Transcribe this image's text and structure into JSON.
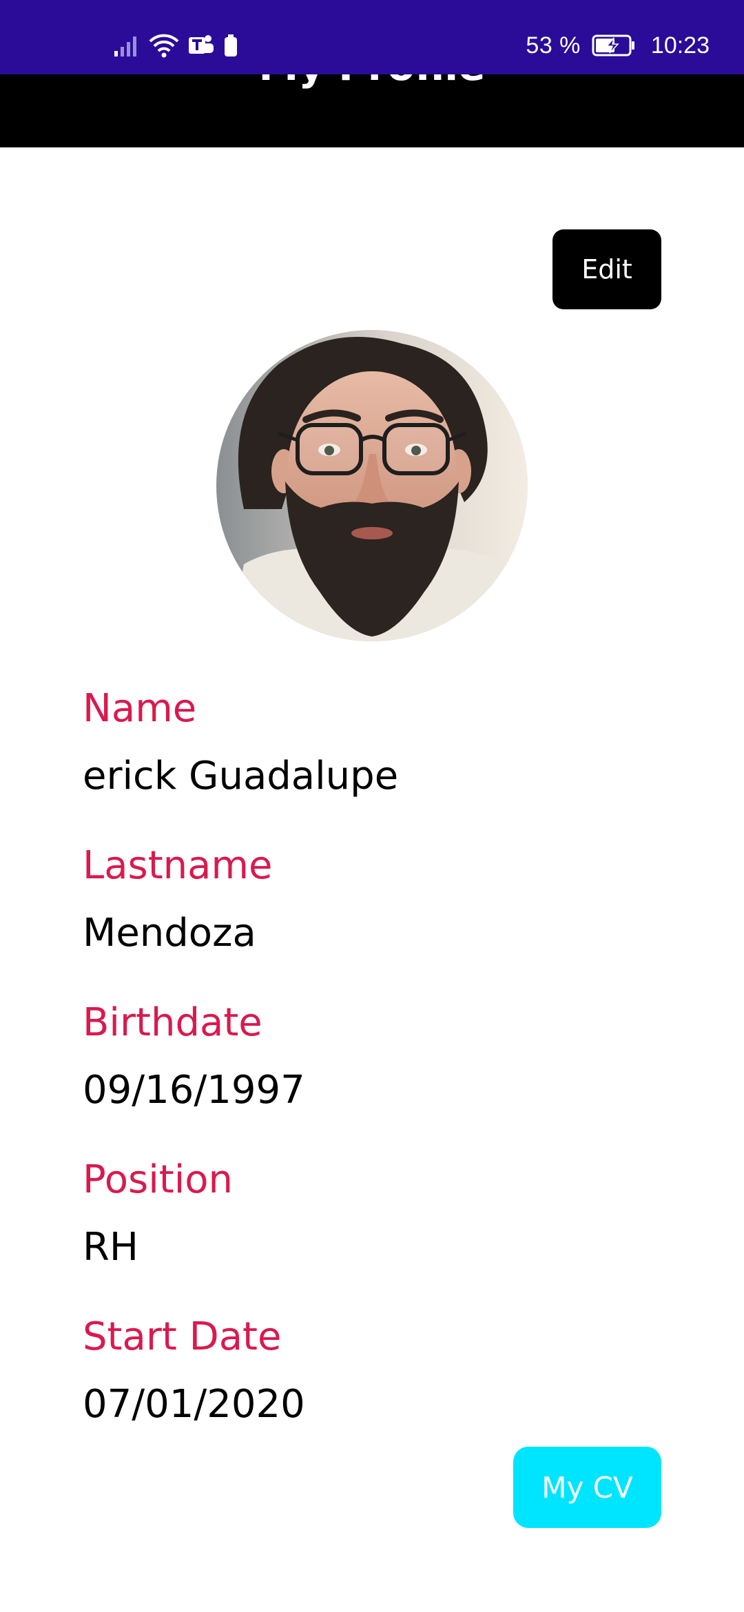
{
  "status_bar": {
    "battery_percent": "53 %",
    "time": "10:23",
    "icons": [
      "signal-icon",
      "wifi-icon",
      "teams-icon",
      "battery-saver-icon",
      "battery-charging-icon"
    ],
    "background": "#2a0c99"
  },
  "app_bar": {
    "title": "My Profile",
    "background": "#000000"
  },
  "actions": {
    "edit_label": "Edit",
    "cv_label": "My CV"
  },
  "profile": {
    "avatar_icon": "profile-photo",
    "fields": [
      {
        "label": "Name",
        "value": "erick Guadalupe"
      },
      {
        "label": "Lastname",
        "value": "Mendoza"
      },
      {
        "label": "Birthdate",
        "value": "09/16/1997"
      },
      {
        "label": "Position",
        "value": "RH"
      },
      {
        "label": "Start Date",
        "value": "07/01/2020"
      }
    ]
  },
  "colors": {
    "label": "#d91a4e",
    "value": "#000000",
    "cv_button": "#00e5ff",
    "edit_button": "#000000"
  }
}
